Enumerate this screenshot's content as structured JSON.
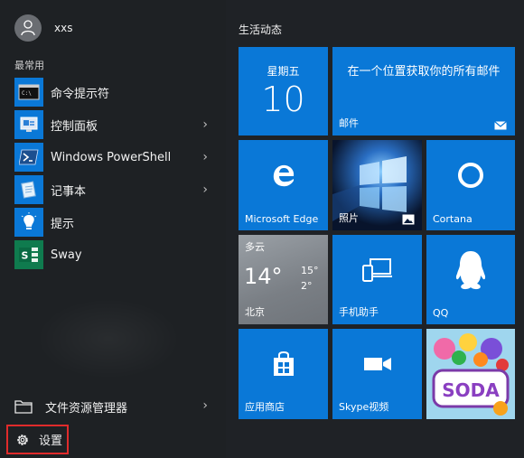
{
  "user": {
    "name": "xxs"
  },
  "most_used_label": "最常用",
  "apps": [
    {
      "label": "命令提示符",
      "icon": "cmd-icon",
      "chevron": false
    },
    {
      "label": "控制面板",
      "icon": "control-panel-icon",
      "chevron": true
    },
    {
      "label": "Windows PowerShell",
      "icon": "powershell-icon",
      "chevron": true
    },
    {
      "label": "记事本",
      "icon": "notepad-icon",
      "chevron": true
    },
    {
      "label": "提示",
      "icon": "tips-icon",
      "chevron": false
    },
    {
      "label": "Sway",
      "icon": "sway-icon",
      "chevron": false
    }
  ],
  "file_explorer_label": "文件资源管理器",
  "settings_label": "设置",
  "tiles_group_title": "生活动态",
  "tiles": {
    "calendar": {
      "weekday": "星期五",
      "day": "10"
    },
    "mail": {
      "text": "在一个位置获取你的所有邮件",
      "label": "邮件"
    },
    "edge": {
      "label": "Microsoft Edge"
    },
    "photos": {
      "label": "照片"
    },
    "cortana": {
      "label": "Cortana"
    },
    "weather": {
      "condition": "多云",
      "temp": "14°",
      "high": "15°",
      "low": "2°",
      "city": "北京"
    },
    "phone": {
      "label": "手机助手"
    },
    "qq": {
      "label": "QQ"
    },
    "store": {
      "label": "应用商店"
    },
    "skype": {
      "label": "Skype视频"
    },
    "candy": {
      "text": "SODA"
    }
  },
  "colors": {
    "tile_blue": "#0a78d7",
    "weather_gray": "#7d8288",
    "highlight_red": "#e02b2b"
  }
}
